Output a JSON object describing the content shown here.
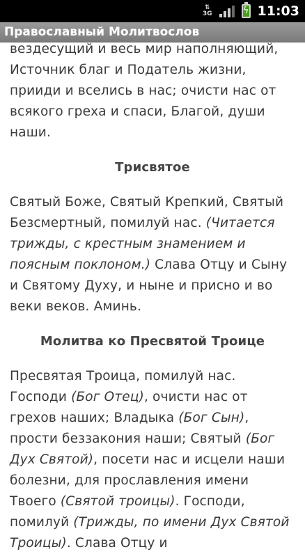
{
  "status": {
    "time": "11:03",
    "network": "3G"
  },
  "app": {
    "title": "Православный Молитвослов"
  },
  "text": {
    "p1": "вездесущий и весь мир наполняющий, Источник благ и Податель жизни, прииди и вселись в нас; очисти нас от всякого греха и спаси, Благой, души наши.",
    "h1": "Трисвятое",
    "p2a": "Святый Боже, Святый Крепкий, Святый Безсмертный, помилуй нас. ",
    "p2i": "(Читается трижды, с крестным знамением и поясным поклоном.)",
    "p2b": " Слава Отцу и Сыну и Святому Духу, и ныне и присно и во веки веков. Аминь.",
    "h2": "Молитва ко Пресвятой Троице",
    "p3a": "Пресвятая Троица, помилуй нас. Господи ",
    "p3i1": "(Бог Отец)",
    "p3b": ", очисти нас от грехов наших; Владыка ",
    "p3i2": "(Бог Сын)",
    "p3c": ", прости беззакония наши; Святый ",
    "p3i3": "(Бог Дух Святой)",
    "p3d": ", посети нас и исцели наши болезни, для прославления имени Твоего ",
    "p3i4": "(Святой троицы)",
    "p3e": ". Господи, помилуй ",
    "p3i5": "(Трижды, по имени Дух Святой Троицы)",
    "p3f": ". Слава Отцу и"
  }
}
